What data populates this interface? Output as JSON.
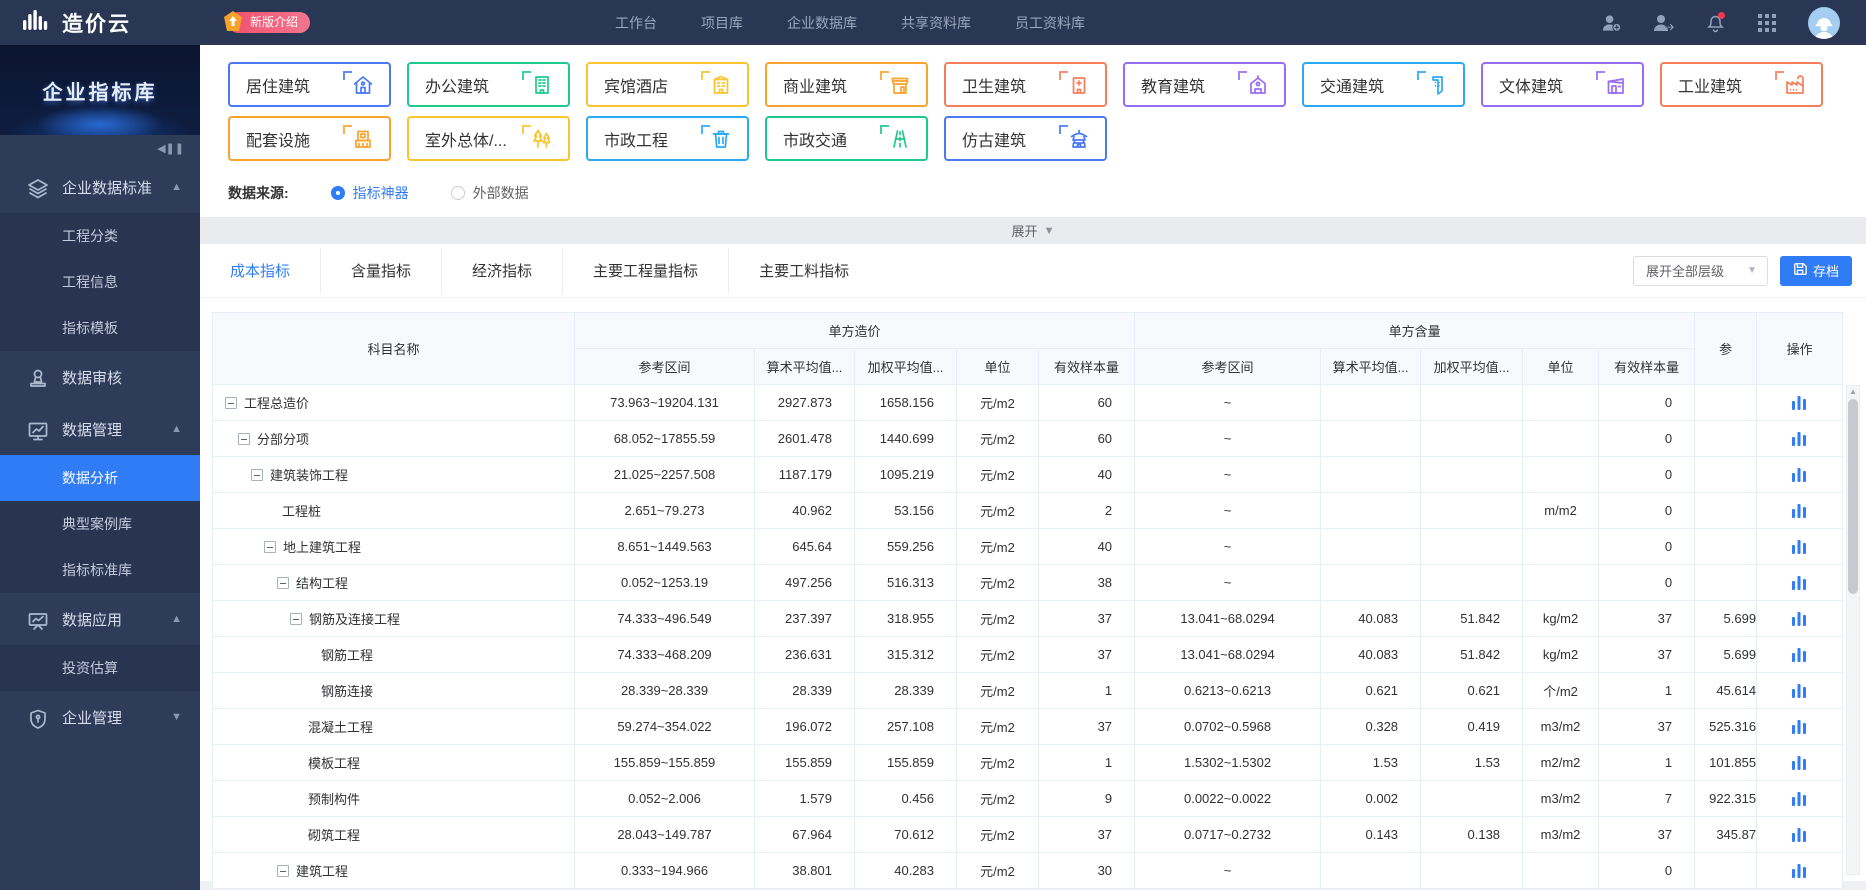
{
  "accent": "#2f7cf6",
  "navbar": {
    "logo_text": "造价云",
    "badge": "新版介绍",
    "items": [
      "工作台",
      "项目库",
      "企业数据库",
      "共享资料库",
      "员工资料库"
    ],
    "icons": [
      "add-user-icon",
      "switch-user-icon",
      "notification-bell-icon",
      "apps-grid-icon",
      "avatar"
    ]
  },
  "sidebar": {
    "banner": "企业指标库",
    "menu": [
      {
        "label": "企业数据标准",
        "icon": "layers-icon",
        "expanded": true,
        "children": [
          {
            "label": "工程分类"
          },
          {
            "label": "工程信息"
          },
          {
            "label": "指标模板"
          }
        ]
      },
      {
        "label": "数据审核",
        "icon": "stamp-icon",
        "expanded": null,
        "children": []
      },
      {
        "label": "数据管理",
        "icon": "monitor-chart-icon",
        "expanded": true,
        "children": [
          {
            "label": "数据分析",
            "active": true
          },
          {
            "label": "典型案例库"
          },
          {
            "label": "指标标准库"
          }
        ]
      },
      {
        "label": "数据应用",
        "icon": "presentation-icon",
        "expanded": true,
        "children": [
          {
            "label": "投资估算"
          }
        ]
      },
      {
        "label": "企业管理",
        "icon": "shield-icon",
        "expanded": false,
        "children": []
      }
    ]
  },
  "filters": {
    "categories": [
      {
        "label": "居住建筑",
        "color": "#4a79f7",
        "icon": "house-icon"
      },
      {
        "label": "办公建筑",
        "color": "#1ec98c",
        "icon": "office-building-icon"
      },
      {
        "label": "宾馆酒店",
        "color": "#f7c52d",
        "icon": "hotel-icon"
      },
      {
        "label": "商业建筑",
        "color": "#f7a32d",
        "icon": "shop-icon"
      },
      {
        "label": "卫生建筑",
        "color": "#f77e5c",
        "icon": "hospital-icon"
      },
      {
        "label": "教育建筑",
        "color": "#9a6cf5",
        "icon": "school-icon"
      },
      {
        "label": "交通建筑",
        "color": "#2aa9f5",
        "icon": "transport-building-icon"
      },
      {
        "label": "文体建筑",
        "color": "#9a6cf5",
        "icon": "stadium-icon"
      },
      {
        "label": "工业建筑",
        "color": "#f77e5c",
        "icon": "factory-icon"
      },
      {
        "label": "配套设施",
        "color": "#f7a32d",
        "icon": "facility-icon"
      },
      {
        "label": "室外总体/...",
        "color": "#f7c52d",
        "icon": "tree-icon"
      },
      {
        "label": "市政工程",
        "color": "#2aa9f5",
        "icon": "municipal-icon"
      },
      {
        "label": "市政交通",
        "color": "#1ec98c",
        "icon": "road-icon"
      },
      {
        "label": "仿古建筑",
        "color": "#4a79f7",
        "icon": "pagoda-icon"
      }
    ],
    "source_label": "数据来源:",
    "sources": [
      {
        "label": "指标神器",
        "selected": true
      },
      {
        "label": "外部数据",
        "selected": false
      }
    ],
    "collapse_label": "展开"
  },
  "toolbar": {
    "tabs": [
      {
        "label": "成本指标",
        "active": true
      },
      {
        "label": "含量指标",
        "active": false
      },
      {
        "label": "经济指标",
        "active": false
      },
      {
        "label": "主要工程量指标",
        "active": false
      },
      {
        "label": "主要工料指标",
        "active": false
      }
    ],
    "level_dropdown": "展开全部层级",
    "save_button": "存档"
  },
  "table": {
    "name_header": "科目名称",
    "cost_group_header": "单方造价",
    "quantity_group_header": "单方含量",
    "action_header": "操作",
    "clipped_header": "参",
    "sub_headers": [
      "参考区间",
      "算术平均值...",
      "加权平均值...",
      "单位",
      "有效样本量"
    ],
    "rows": [
      {
        "name": "工程总造价",
        "level": 0,
        "expandable": true,
        "cost": {
          "range": "73.963~19204.131",
          "avg": "2927.873",
          "wavg": "1658.156",
          "unit": "元/m2",
          "count": "60"
        },
        "qty": {
          "range": "~",
          "avg": "",
          "wavg": "",
          "unit": "",
          "count": "0"
        },
        "extra": ""
      },
      {
        "name": "分部分项",
        "level": 1,
        "expandable": true,
        "cost": {
          "range": "68.052~17855.59",
          "avg": "2601.478",
          "wavg": "1440.699",
          "unit": "元/m2",
          "count": "60"
        },
        "qty": {
          "range": "~",
          "avg": "",
          "wavg": "",
          "unit": "",
          "count": "0"
        },
        "extra": ""
      },
      {
        "name": "建筑装饰工程",
        "level": 2,
        "expandable": true,
        "cost": {
          "range": "21.025~2257.508",
          "avg": "1187.179",
          "wavg": "1095.219",
          "unit": "元/m2",
          "count": "40"
        },
        "qty": {
          "range": "~",
          "avg": "",
          "wavg": "",
          "unit": "",
          "count": "0"
        },
        "extra": ""
      },
      {
        "name": "工程桩",
        "level": 3,
        "expandable": false,
        "cost": {
          "range": "2.651~79.273",
          "avg": "40.962",
          "wavg": "53.156",
          "unit": "元/m2",
          "count": "2"
        },
        "qty": {
          "range": "~",
          "avg": "",
          "wavg": "",
          "unit": "m/m2",
          "count": "0"
        },
        "extra": ""
      },
      {
        "name": "地上建筑工程",
        "level": 3,
        "expandable": true,
        "cost": {
          "range": "8.651~1449.563",
          "avg": "645.64",
          "wavg": "559.256",
          "unit": "元/m2",
          "count": "40"
        },
        "qty": {
          "range": "~",
          "avg": "",
          "wavg": "",
          "unit": "",
          "count": "0"
        },
        "extra": ""
      },
      {
        "name": "结构工程",
        "level": 4,
        "expandable": true,
        "cost": {
          "range": "0.052~1253.19",
          "avg": "497.256",
          "wavg": "516.313",
          "unit": "元/m2",
          "count": "38"
        },
        "qty": {
          "range": "~",
          "avg": "",
          "wavg": "",
          "unit": "",
          "count": "0"
        },
        "extra": ""
      },
      {
        "name": "钢筋及连接工程",
        "level": 5,
        "expandable": true,
        "cost": {
          "range": "74.333~496.549",
          "avg": "237.397",
          "wavg": "318.955",
          "unit": "元/m2",
          "count": "37"
        },
        "qty": {
          "range": "13.041~68.0294",
          "avg": "40.083",
          "wavg": "51.842",
          "unit": "kg/m2",
          "count": "37"
        },
        "extra": "5.699"
      },
      {
        "name": "钢筋工程",
        "level": 6,
        "expandable": false,
        "cost": {
          "range": "74.333~468.209",
          "avg": "236.631",
          "wavg": "315.312",
          "unit": "元/m2",
          "count": "37"
        },
        "qty": {
          "range": "13.041~68.0294",
          "avg": "40.083",
          "wavg": "51.842",
          "unit": "kg/m2",
          "count": "37"
        },
        "extra": "5.699"
      },
      {
        "name": "钢筋连接",
        "level": 6,
        "expandable": false,
        "cost": {
          "range": "28.339~28.339",
          "avg": "28.339",
          "wavg": "28.339",
          "unit": "元/m2",
          "count": "1"
        },
        "qty": {
          "range": "0.6213~0.6213",
          "avg": "0.621",
          "wavg": "0.621",
          "unit": "个/m2",
          "count": "1"
        },
        "extra": "45.614"
      },
      {
        "name": "混凝土工程",
        "level": 5,
        "expandable": false,
        "cost": {
          "range": "59.274~354.022",
          "avg": "196.072",
          "wavg": "257.108",
          "unit": "元/m2",
          "count": "37"
        },
        "qty": {
          "range": "0.0702~0.5968",
          "avg": "0.328",
          "wavg": "0.419",
          "unit": "m3/m2",
          "count": "37"
        },
        "extra": "525.316"
      },
      {
        "name": "模板工程",
        "level": 5,
        "expandable": false,
        "cost": {
          "range": "155.859~155.859",
          "avg": "155.859",
          "wavg": "155.859",
          "unit": "元/m2",
          "count": "1"
        },
        "qty": {
          "range": "1.5302~1.5302",
          "avg": "1.53",
          "wavg": "1.53",
          "unit": "m2/m2",
          "count": "1"
        },
        "extra": "101.855"
      },
      {
        "name": "预制构件",
        "level": 5,
        "expandable": false,
        "cost": {
          "range": "0.052~2.006",
          "avg": "1.579",
          "wavg": "0.456",
          "unit": "元/m2",
          "count": "9"
        },
        "qty": {
          "range": "0.0022~0.0022",
          "avg": "0.002",
          "wavg": "",
          "unit": "m3/m2",
          "count": "7"
        },
        "extra": "922.315"
      },
      {
        "name": "砌筑工程",
        "level": 5,
        "expandable": false,
        "cost": {
          "range": "28.043~149.787",
          "avg": "67.964",
          "wavg": "70.612",
          "unit": "元/m2",
          "count": "37"
        },
        "qty": {
          "range": "0.0717~0.2732",
          "avg": "0.143",
          "wavg": "0.138",
          "unit": "m3/m2",
          "count": "37"
        },
        "extra": "345.87"
      },
      {
        "name": "建筑工程",
        "level": 4,
        "expandable": true,
        "cost": {
          "range": "0.333~194.966",
          "avg": "38.801",
          "wavg": "40.283",
          "unit": "元/m2",
          "count": "30"
        },
        "qty": {
          "range": "~",
          "avg": "",
          "wavg": "",
          "unit": "",
          "count": "0"
        },
        "extra": ""
      }
    ]
  }
}
